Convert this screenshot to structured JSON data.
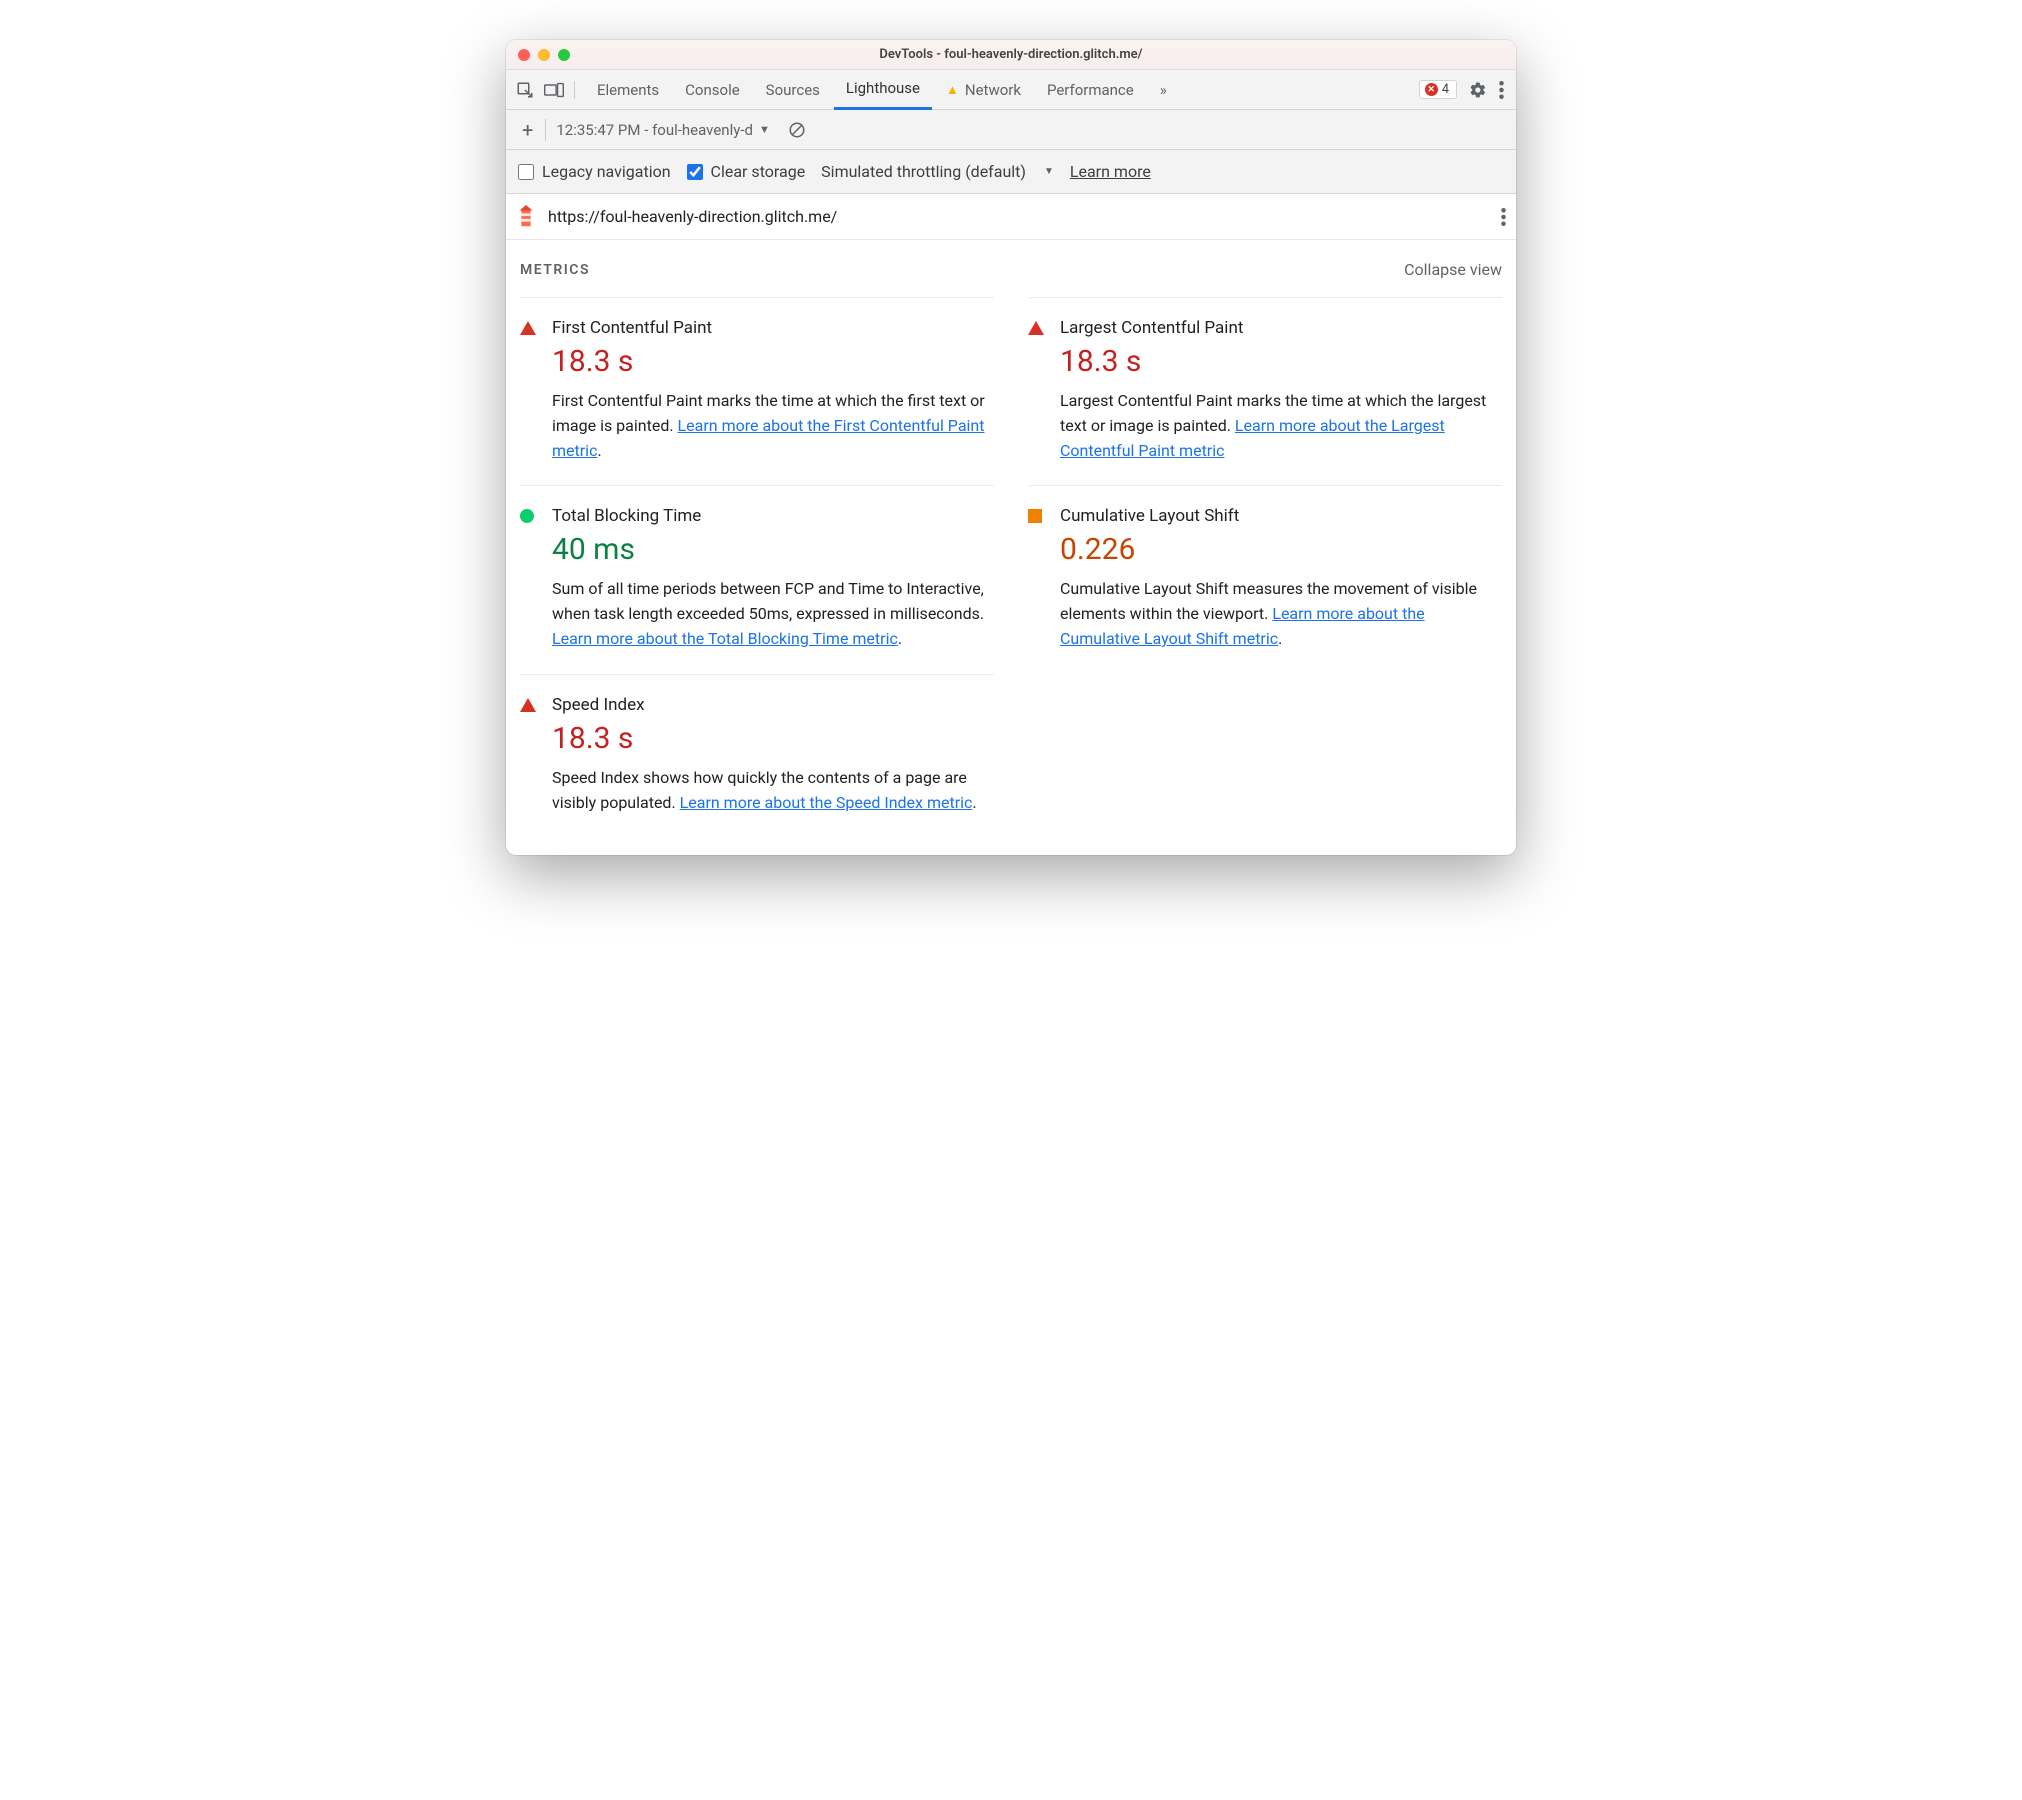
{
  "window": {
    "title": "DevTools - foul-heavenly-direction.glitch.me/"
  },
  "mainTabs": {
    "items": [
      "Elements",
      "Console",
      "Sources",
      "Lighthouse",
      "Network",
      "Performance"
    ],
    "overflow": "»",
    "activeIndex": 3,
    "errorCount": "4"
  },
  "session": {
    "label": "12:35:47 PM - foul-heavenly-d"
  },
  "settings": {
    "legacy": "Legacy navigation",
    "clear": "Clear storage",
    "throttle": "Simulated throttling (default)",
    "learn": "Learn more"
  },
  "url": "https://foul-heavenly-direction.glitch.me/",
  "metricsHeader": {
    "title": "METRICS",
    "collapse": "Collapse view"
  },
  "metrics": [
    {
      "id": "fcp",
      "name": "First Contentful Paint",
      "value": "18.3 s",
      "status": "red",
      "desc": "First Contentful Paint marks the time at which the first text or image is painted. ",
      "link": "Learn more about the First Contentful Paint metric",
      "after": "."
    },
    {
      "id": "lcp",
      "name": "Largest Contentful Paint",
      "value": "18.3 s",
      "status": "red",
      "desc": "Largest Contentful Paint marks the time at which the largest text or image is painted. ",
      "link": "Learn more about the Largest Contentful Paint metric",
      "after": ""
    },
    {
      "id": "tbt",
      "name": "Total Blocking Time",
      "value": "40 ms",
      "status": "green",
      "desc": "Sum of all time periods between FCP and Time to Interactive, when task length exceeded 50ms, expressed in milliseconds. ",
      "link": "Learn more about the Total Blocking Time metric",
      "after": "."
    },
    {
      "id": "cls",
      "name": "Cumulative Layout Shift",
      "value": "0.226",
      "status": "orange",
      "desc": "Cumulative Layout Shift measures the movement of visible elements within the viewport. ",
      "link": "Learn more about the Cumulative Layout Shift metric",
      "after": "."
    },
    {
      "id": "si",
      "name": "Speed Index",
      "value": "18.3 s",
      "status": "red",
      "desc": "Speed Index shows how quickly the contents of a page are visibly populated. ",
      "link": "Learn more about the Speed Index metric",
      "after": "."
    }
  ]
}
